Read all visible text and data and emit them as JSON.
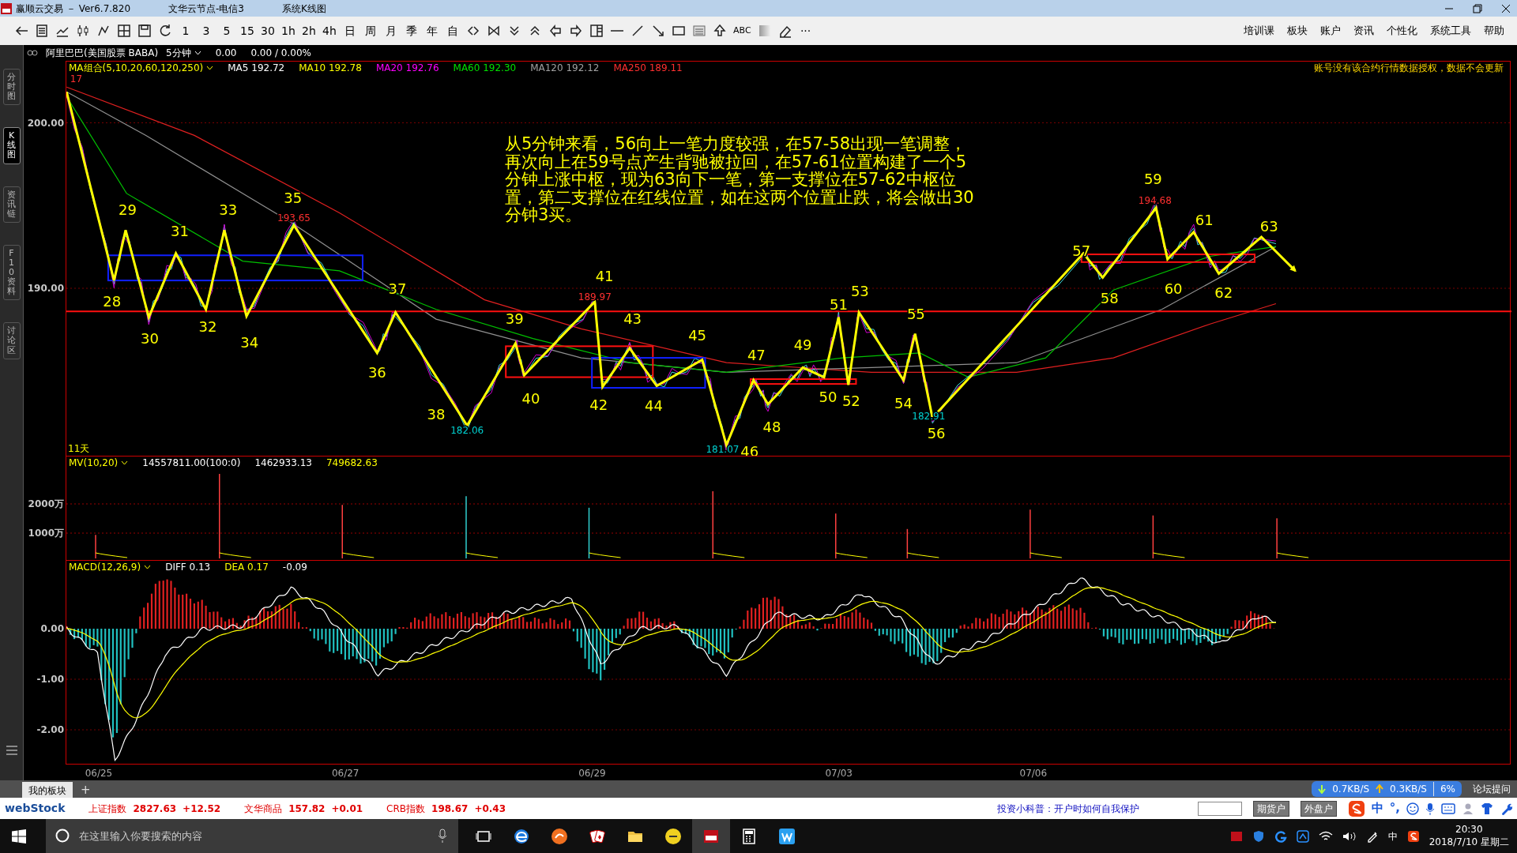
{
  "title_bar": {
    "app": "赢顺云交易 － Ver6.7.820",
    "server": "文华云节点-电信3",
    "view": "系统K线图"
  },
  "toolbar": {
    "periods": [
      "1",
      "3",
      "5",
      "15",
      "30",
      "1h",
      "2h",
      "4h",
      "日",
      "周",
      "月",
      "季",
      "年",
      "自"
    ],
    "text_tool": "ABC",
    "more": "···",
    "menu": [
      "培训课",
      "板块",
      "账户",
      "资讯",
      "个性化",
      "系统工具",
      "帮助"
    ]
  },
  "side_tabs": [
    {
      "label": "分时图",
      "selected": false
    },
    {
      "label": "K线图",
      "selected": true
    },
    {
      "label": "资讯链",
      "selected": false
    },
    {
      "label": "F10资料",
      "selected": false
    },
    {
      "label": "讨论区",
      "selected": false
    }
  ],
  "instrument": {
    "name": "阿里巴巴(美国股票 BABA)",
    "period": "5分钟",
    "price": "0.00",
    "change": "0.00 / 0.00%"
  },
  "price_panel": {
    "legend": [
      {
        "text": "MA组合(5,10,20,60,120,250)",
        "color": "#ffff00"
      },
      {
        "text": "MA5 192.72",
        "color": "#ffffff"
      },
      {
        "text": "MA10 192.78",
        "color": "#ffff00"
      },
      {
        "text": "MA20 192.76",
        "color": "#ff00ff"
      },
      {
        "text": "MA60 192.30",
        "color": "#00e000"
      },
      {
        "text": "MA120 192.12",
        "color": "#a0a0a0"
      },
      {
        "text": "MA250 189.11",
        "color": "#ff3030"
      }
    ],
    "notice": "账号没有该合约行情数据授权，数据不会更新",
    "y_labels": [
      "200.00",
      "190.00"
    ],
    "days": "11天",
    "price_marks": [
      {
        "text": "17",
        "color": "#ff3030"
      },
      {
        "text": "193.65",
        "color": "#ff3030"
      },
      {
        "text": "189.97",
        "color": "#ff3030"
      },
      {
        "text": "182.06",
        "color": "#00d0d0"
      },
      {
        "text": "181.07",
        "color": "#00d0d0"
      },
      {
        "text": "182.91",
        "color": "#00d0d0"
      },
      {
        "text": "194.68",
        "color": "#ff3030"
      }
    ],
    "wave_labels": [
      "28",
      "29",
      "30",
      "31",
      "32",
      "33",
      "34",
      "35",
      "36",
      "37",
      "38",
      "39",
      "40",
      "41",
      "42",
      "43",
      "44",
      "45",
      "46",
      "47",
      "48",
      "49",
      "50",
      "51",
      "52",
      "53",
      "54",
      "55",
      "56",
      "57",
      "58",
      "59",
      "60",
      "61",
      "62",
      "63"
    ],
    "annotation": "从5分钟来看，56向上一笔力度较强，在57-58出现一笔调整，再次向上在59号点产生背驰被拉回，在57-61位置构建了一个5分钟上涨中枢，现为63向下一笔，第一支撑位在57-62中枢位置，第二支撑位在红线位置，如在这两个位置止跌，将会做出30分钟3买。"
  },
  "volume_panel": {
    "legend": [
      {
        "text": "MV(10,20)",
        "color": "#ffff00"
      },
      {
        "text": "14557811.00(100:0)",
        "color": "#ffffff"
      },
      {
        "text": "1462933.13",
        "color": "#ffffff"
      },
      {
        "text": "749682.63",
        "color": "#ffff00"
      }
    ],
    "y_labels": [
      "2000万",
      "1000万"
    ]
  },
  "macd_panel": {
    "legend": [
      {
        "text": "MACD(12,26,9)",
        "color": "#ffff00"
      },
      {
        "text": "DIFF 0.13",
        "color": "#ffffff"
      },
      {
        "text": "DEA 0.17",
        "color": "#ffff00"
      },
      {
        "text": "-0.09",
        "color": "#ffffff"
      }
    ],
    "y_labels": [
      "0.00",
      "-1.00",
      "-2.00"
    ]
  },
  "dates": [
    "06/25",
    "06/27",
    "06/29",
    "07/03",
    "07/06"
  ],
  "tabs": [
    {
      "label": "我的板块",
      "selected": true
    }
  ],
  "add_tab": "+",
  "net_widget": {
    "down": "0.7KB/S",
    "up": "0.3KB/S",
    "cpu": "6%"
  },
  "forum": "论坛提问",
  "ticker": {
    "logo": "webStock",
    "items": [
      {
        "name": "上证指数",
        "value": "2827.63",
        "change": "+12.52"
      },
      {
        "name": "文华商品",
        "value": "157.82",
        "change": "+0.01"
      },
      {
        "name": "CRB指数",
        "value": "198.67",
        "change": "+0.43"
      }
    ],
    "news": "投资小科普：开户时如何自我保护",
    "account_buttons": [
      "期货户",
      "外盘户"
    ],
    "ime_mode": "中",
    "ime_punct": "°,"
  },
  "taskbar": {
    "search_placeholder": "在这里输入你要搜索的内容",
    "ime": "中",
    "time": "20:30",
    "date": "2018/7/10 星期二"
  }
}
